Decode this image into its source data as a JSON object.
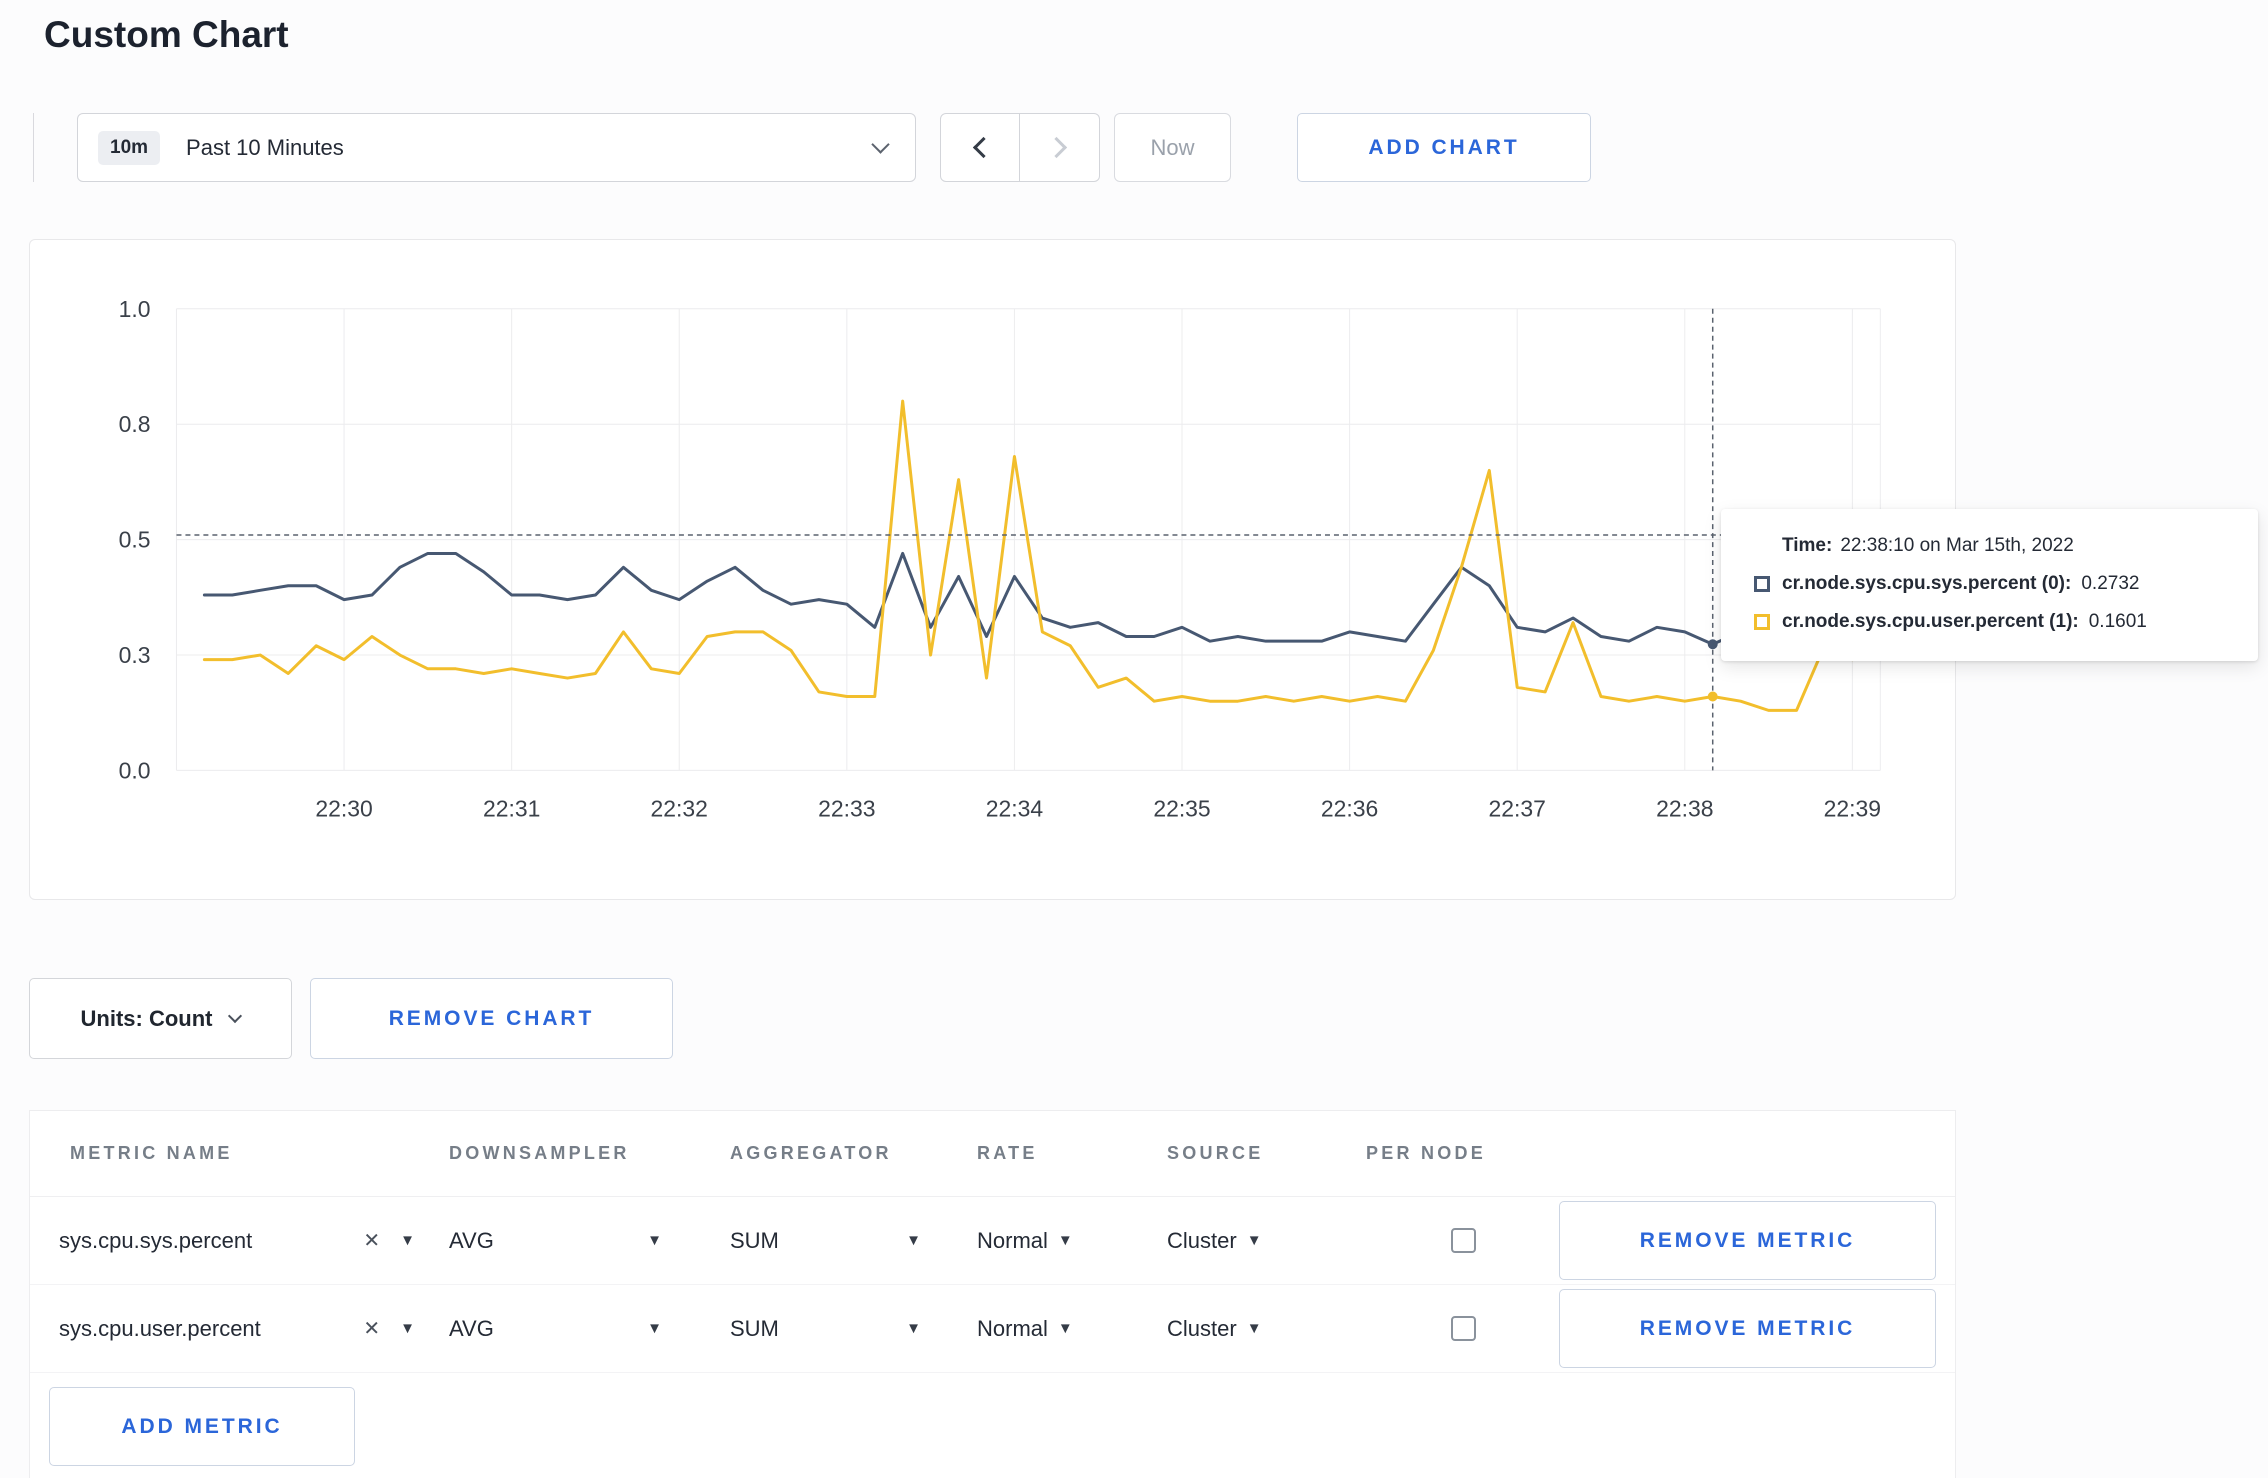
{
  "colors": {
    "accent_blue": "#2b66d9",
    "series_sys": "#475872",
    "series_user": "#f2be2c",
    "grid": "#ececee",
    "crosshair": "#5a626e"
  },
  "page": {
    "title": "Custom Chart"
  },
  "toolbar": {
    "time_window": {
      "badge": "10m",
      "label": "Past 10 Minutes"
    },
    "now_label": "Now",
    "add_chart_label": "ADD CHART"
  },
  "chart_data": {
    "type": "line",
    "title": "",
    "xlabel": "",
    "ylabel": "",
    "ylim": [
      0,
      1
    ],
    "grid": true,
    "legend_position": "tooltip",
    "x_tick_labels": [
      "22:30",
      "22:31",
      "22:32",
      "22:33",
      "22:34",
      "22:35",
      "22:36",
      "22:37",
      "22:38",
      "22:39"
    ],
    "y_ticks": [
      {
        "label": "1.0",
        "value": 1.0
      },
      {
        "label": "0.8",
        "value": 0.75
      },
      {
        "label": "0.5",
        "value": 0.5
      },
      {
        "label": "0.3",
        "value": 0.25
      },
      {
        "label": "0.0",
        "value": 0.0
      }
    ],
    "domain_start_time": "22:29:00",
    "domain_seconds": 610,
    "first_tick_offset_seconds": 60,
    "sample_start_seconds": 10,
    "sample_interval_seconds": 10,
    "series": [
      {
        "name": "cr.node.sys.cpu.sys.percent",
        "color": "#475872",
        "values": [
          0.38,
          0.38,
          0.39,
          0.4,
          0.4,
          0.37,
          0.38,
          0.44,
          0.47,
          0.47,
          0.43,
          0.38,
          0.38,
          0.37,
          0.38,
          0.44,
          0.39,
          0.37,
          0.41,
          0.44,
          0.39,
          0.36,
          0.37,
          0.36,
          0.31,
          0.47,
          0.31,
          0.42,
          0.29,
          0.42,
          0.33,
          0.31,
          0.32,
          0.29,
          0.29,
          0.31,
          0.28,
          0.29,
          0.28,
          0.28,
          0.28,
          0.3,
          0.29,
          0.28,
          0.36,
          0.44,
          0.4,
          0.31,
          0.3,
          0.33,
          0.29,
          0.28,
          0.31,
          0.3,
          0.2732,
          0.3,
          0.31,
          0.3,
          0.31,
          0.31
        ]
      },
      {
        "name": "cr.node.sys.cpu.user.percent",
        "color": "#f2be2c",
        "values": [
          0.24,
          0.24,
          0.25,
          0.21,
          0.27,
          0.24,
          0.29,
          0.25,
          0.22,
          0.22,
          0.21,
          0.22,
          0.21,
          0.2,
          0.21,
          0.3,
          0.22,
          0.21,
          0.29,
          0.3,
          0.3,
          0.26,
          0.17,
          0.16,
          0.16,
          0.8,
          0.25,
          0.63,
          0.2,
          0.68,
          0.3,
          0.27,
          0.18,
          0.2,
          0.15,
          0.16,
          0.15,
          0.15,
          0.16,
          0.15,
          0.16,
          0.15,
          0.16,
          0.15,
          0.26,
          0.44,
          0.65,
          0.18,
          0.17,
          0.32,
          0.16,
          0.15,
          0.16,
          0.15,
          0.1601,
          0.15,
          0.13,
          0.13,
          0.27,
          0.24
        ]
      }
    ],
    "crosshair": {
      "time": "22:38:10",
      "t_seconds": 550,
      "hline_value": 0.51,
      "points": [
        {
          "series": 0,
          "value": 0.2732
        },
        {
          "series": 1,
          "value": 0.1601
        }
      ]
    }
  },
  "tooltip": {
    "time_label": "Time:",
    "time_value": "22:38:10 on Mar 15th, 2022",
    "rows": [
      {
        "name": "cr.node.sys.cpu.sys.percent (0):",
        "value": "0.2732",
        "color": "#475872"
      },
      {
        "name": "cr.node.sys.cpu.user.percent (1):",
        "value": "0.1601",
        "color": "#f2be2c"
      }
    ]
  },
  "chart_controls": {
    "units_label": "Units: Count",
    "remove_chart_label": "REMOVE CHART"
  },
  "metrics_table": {
    "headers": [
      "METRIC NAME",
      "DOWNSAMPLER",
      "AGGREGATOR",
      "RATE",
      "SOURCE",
      "PER NODE"
    ],
    "rows": [
      {
        "metric": "sys.cpu.sys.percent",
        "downsampler": "AVG",
        "aggregator": "SUM",
        "rate": "Normal",
        "source": "Cluster",
        "per_node_checked": false,
        "remove_label": "REMOVE METRIC"
      },
      {
        "metric": "sys.cpu.user.percent",
        "downsampler": "AVG",
        "aggregator": "SUM",
        "rate": "Normal",
        "source": "Cluster",
        "per_node_checked": false,
        "remove_label": "REMOVE METRIC"
      }
    ],
    "add_metric_label": "ADD METRIC"
  }
}
